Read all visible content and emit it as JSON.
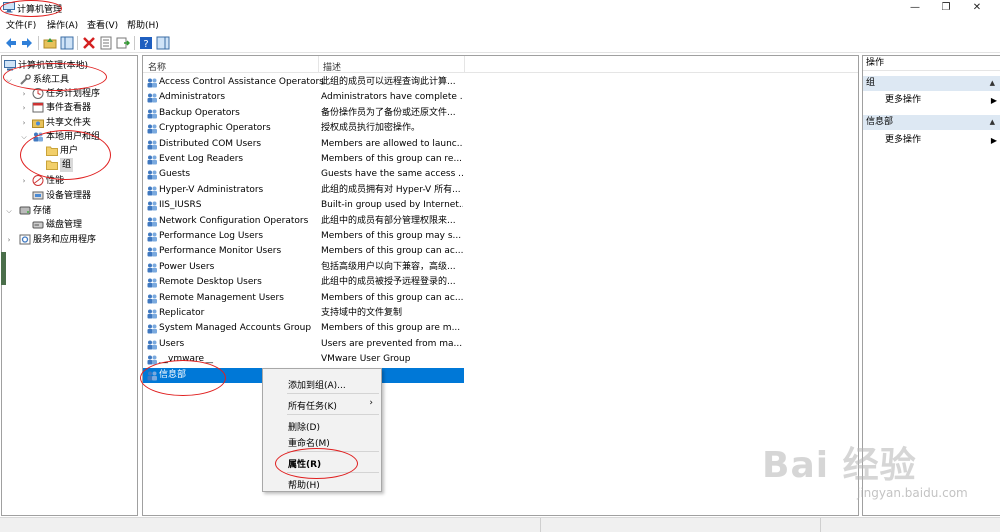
{
  "window": {
    "title": "计算机管理"
  },
  "menu": [
    "文件(F)",
    "操作(A)",
    "查看(V)",
    "帮助(H)"
  ],
  "tree": [
    {
      "label": "计算机管理(本地)",
      "icon": "computer-icon",
      "arrow": ""
    },
    {
      "label": "系统工具",
      "icon": "tools-icon",
      "arrow": "expanded"
    },
    {
      "label": "任务计划程序",
      "icon": "clock-icon",
      "arrow": "collapsed"
    },
    {
      "label": "事件查看器",
      "icon": "event-icon",
      "arrow": "collapsed"
    },
    {
      "label": "共享文件夹",
      "icon": "share-icon",
      "arrow": "collapsed"
    },
    {
      "label": "本地用户和组",
      "icon": "users-icon",
      "arrow": "expanded"
    },
    {
      "label": "用户",
      "icon": "folder-icon",
      "arrow": ""
    },
    {
      "label": "组",
      "icon": "folder-icon",
      "arrow": "",
      "selected": true
    },
    {
      "label": "性能",
      "icon": "performance-icon",
      "arrow": "collapsed"
    },
    {
      "label": "设备管理器",
      "icon": "device-icon",
      "arrow": ""
    },
    {
      "label": "存储",
      "icon": "storage-icon",
      "arrow": "expanded"
    },
    {
      "label": "磁盘管理",
      "icon": "disk-icon",
      "arrow": ""
    },
    {
      "label": "服务和应用程序",
      "icon": "services-icon",
      "arrow": "collapsed"
    }
  ],
  "list": {
    "columns": [
      "名称",
      "描述"
    ],
    "rows": [
      {
        "name": "Access Control Assistance Operators",
        "desc": "此组的成员可以远程查询此计算..."
      },
      {
        "name": "Administrators",
        "desc": "Administrators have complete ..."
      },
      {
        "name": "Backup Operators",
        "desc": "备份操作员为了备份或还原文件..."
      },
      {
        "name": "Cryptographic Operators",
        "desc": "授权成员执行加密操作。"
      },
      {
        "name": "Distributed COM Users",
        "desc": "Members are allowed to launc..."
      },
      {
        "name": "Event Log Readers",
        "desc": "Members of this group can re..."
      },
      {
        "name": "Guests",
        "desc": "Guests have the same access ..."
      },
      {
        "name": "Hyper-V Administrators",
        "desc": "此组的成员拥有对 Hyper-V 所有..."
      },
      {
        "name": "IIS_IUSRS",
        "desc": "Built-in group used by Internet..."
      },
      {
        "name": "Network Configuration Operators",
        "desc": "此组中的成员有部分管理权限来..."
      },
      {
        "name": "Performance Log Users",
        "desc": "Members of this group may s..."
      },
      {
        "name": "Performance Monitor Users",
        "desc": "Members of this group can ac..."
      },
      {
        "name": "Power Users",
        "desc": "包括高级用户以向下兼容，高级..."
      },
      {
        "name": "Remote Desktop Users",
        "desc": "此组中的成员被授予远程登录的..."
      },
      {
        "name": "Remote Management Users",
        "desc": "Members of this group can ac..."
      },
      {
        "name": "Replicator",
        "desc": "支持域中的文件复制"
      },
      {
        "name": "System Managed Accounts Group",
        "desc": "Members of this group are m..."
      },
      {
        "name": "Users",
        "desc": "Users are prevented from ma..."
      },
      {
        "name": "__vmware__",
        "desc": "VMware User Group"
      },
      {
        "name": "信息部",
        "desc": "",
        "selected": true
      }
    ]
  },
  "actions": {
    "header": "操作",
    "sections": [
      {
        "title": "组",
        "items": [
          "更多操作"
        ]
      },
      {
        "title": "信息部",
        "items": [
          "更多操作"
        ]
      }
    ]
  },
  "context_menu": {
    "items": [
      "添加到组(A)...",
      "所有任务(K)",
      "删除(D)",
      "重命名(M)",
      "属性(R)",
      "帮助(H)"
    ],
    "submenu_indicator": "›"
  },
  "watermark": {
    "brand": "Bai 经验",
    "url": "jingyan.baidu.com"
  },
  "colors": {
    "selection": "#0078d7",
    "annotation": "#e02020",
    "action_section_bg": "#dde8f3"
  }
}
